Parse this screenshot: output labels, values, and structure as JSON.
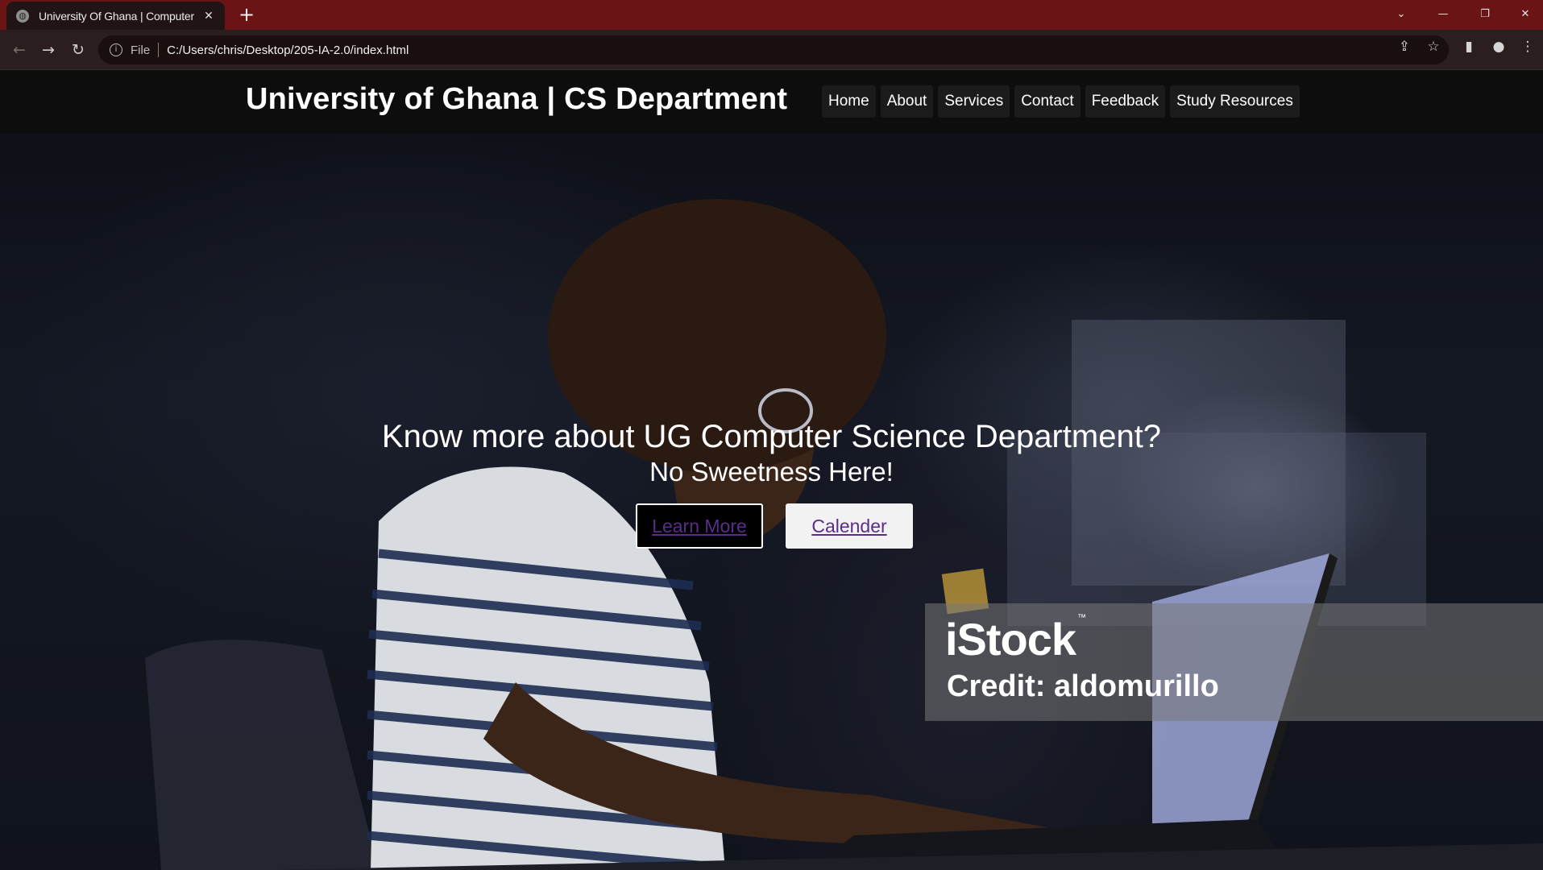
{
  "browser": {
    "tab_title": "University Of Ghana | Computer Science",
    "tab_close": "✕",
    "new_tab": "+",
    "scheme": "File",
    "url": "C:/Users/chris/Desktop/205-IA-2.0/index.html",
    "icons": {
      "back": "←",
      "forward": "→",
      "reload": "↻",
      "info": "i",
      "share": "⇪",
      "bookmark": "☆",
      "sidepanel": "▮",
      "profile": "●",
      "menu": "⋮",
      "tabsearch": "⌄",
      "minimize": "—",
      "restore": "❐",
      "close": "✕"
    }
  },
  "header": {
    "brand": "University of Ghana | CS Department",
    "nav": [
      "Home",
      "About",
      "Services",
      "Contact",
      "Feedback",
      "Study Resources"
    ]
  },
  "hero": {
    "headline": "Know more about UG Computer Science Department?",
    "subheadline": "No Sweetness Here!",
    "learn_more": "Learn More",
    "calender": "Calender"
  },
  "watermark": {
    "logo": "iStock",
    "tm": "™",
    "credit": "Credit: aldomurillo"
  },
  "colors": {
    "tabstrip": "#6b1416",
    "toolbar": "#2b1e1e",
    "header": "#0d0d0d",
    "link_purple": "#5b2d8a"
  }
}
